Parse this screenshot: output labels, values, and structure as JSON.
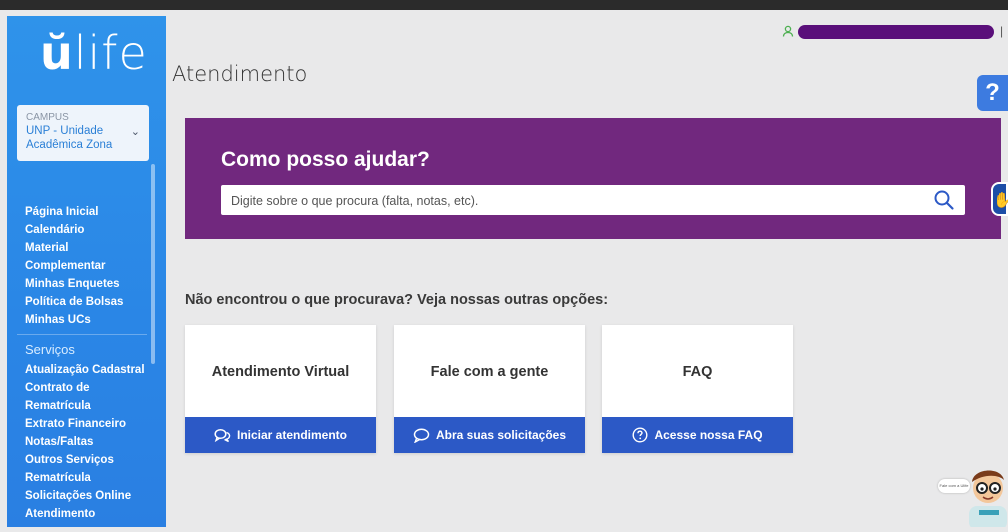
{
  "logo": {
    "text_strong": "ŭ",
    "text_light": "life"
  },
  "campus": {
    "label": "CAMPUS",
    "value": "UNP - Unidade Acadêmica Zona"
  },
  "menu": {
    "items": [
      {
        "label": "Página Inicial"
      },
      {
        "label": "Calendário"
      },
      {
        "label": "Material"
      },
      {
        "label": "Complementar"
      },
      {
        "label": "Minhas Enquetes"
      },
      {
        "label": "Política de Bolsas"
      },
      {
        "label": "Minhas UCs"
      }
    ],
    "services_title": "Serviços",
    "services": [
      {
        "label": "Atualização Cadastral"
      },
      {
        "label": "Contrato de"
      },
      {
        "label": "Rematrícula"
      },
      {
        "label": "Extrato Financeiro"
      },
      {
        "label": "Notas/Faltas"
      },
      {
        "label": "Outros Serviços"
      },
      {
        "label": "Rematrícula"
      },
      {
        "label": "Solicitações Online"
      },
      {
        "label": "Atendimento"
      }
    ]
  },
  "header": {
    "page_title": "Atendimento"
  },
  "hero": {
    "title": "Como posso ajudar?",
    "search_placeholder": "Digite sobre o que procura (falta, notas, etc).",
    "accent_color": "#71287e"
  },
  "options": {
    "heading": "Não encontrou o que procurava? Veja nossas outras opções:",
    "cards": [
      {
        "title": "Atendimento Virtual",
        "button": "Iniciar atendimento",
        "icon": "chat-bubbles-icon"
      },
      {
        "title": "Fale com a gente",
        "button": "Abra suas solicitações",
        "icon": "speech-bubble-icon"
      },
      {
        "title": "FAQ",
        "button": "Acesse nossa FAQ",
        "icon": "question-circle-icon"
      }
    ],
    "button_color": "#2c59c6"
  },
  "floating": {
    "help_label": "?",
    "a11y_label": "✋",
    "bubble_text": "Fale com a Ulife"
  }
}
